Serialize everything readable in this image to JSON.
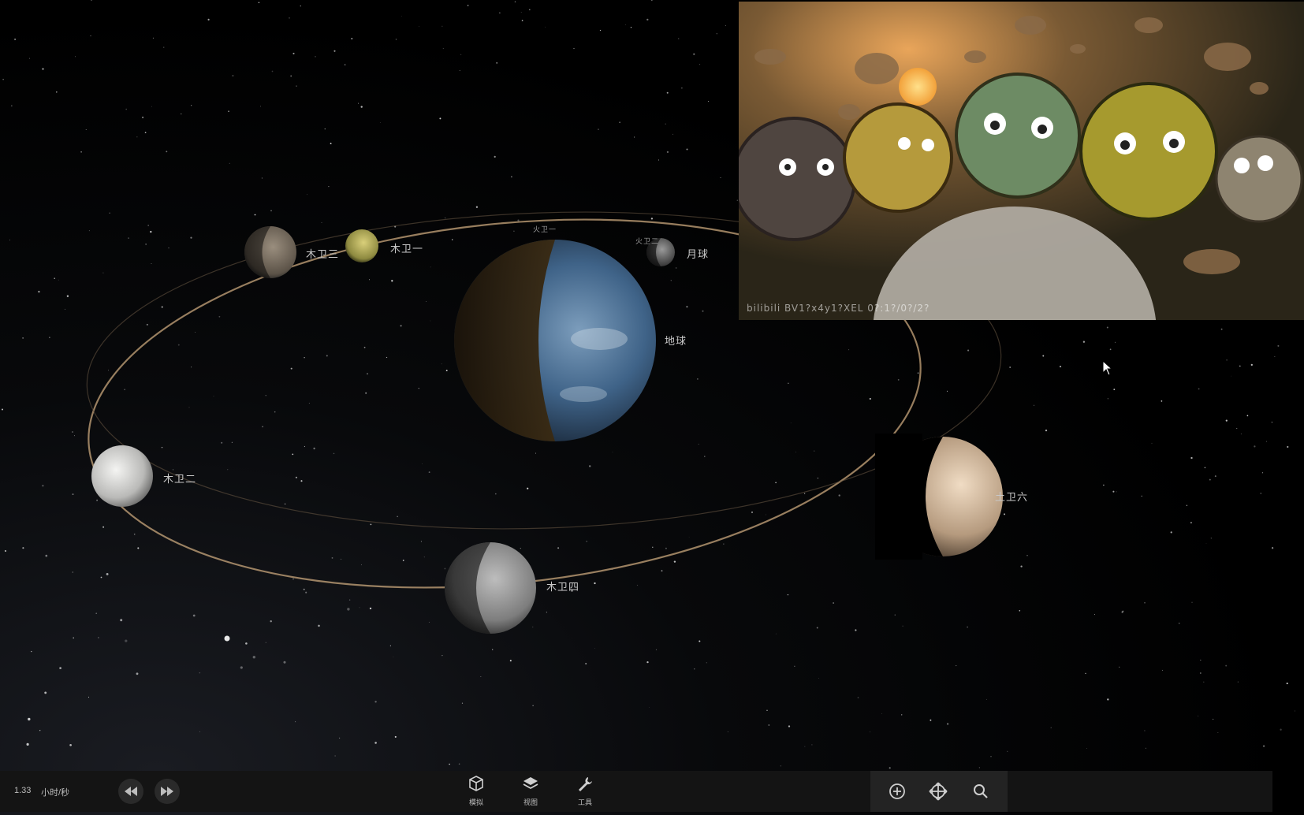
{
  "scene": {
    "bodies": [
      {
        "id": "callisto",
        "label": "木卫四"
      },
      {
        "id": "europa",
        "label": "木卫二"
      },
      {
        "id": "ganymede",
        "label": "木卫三"
      },
      {
        "id": "io",
        "label": "木卫一"
      },
      {
        "id": "earth",
        "label": "地球"
      },
      {
        "id": "moon",
        "label": "月球"
      },
      {
        "id": "titan",
        "label": "土卫六"
      },
      {
        "id": "phobos",
        "label": "火卫一"
      },
      {
        "id": "deimos",
        "label": "火卫二"
      }
    ],
    "colors": {
      "orbit": "#c9a77c",
      "background": "#000000"
    }
  },
  "inset": {
    "watermark": "bilibili BV1?x4y1?XEL 0?:1?/0?/2?"
  },
  "toolbar": {
    "speed_value": "1.33",
    "speed_unit": "小时/秒",
    "rewind_icon": "rewind-icon",
    "forward_icon": "fast-forward-icon",
    "menu": [
      {
        "label": "模拟",
        "icon": "cube-icon"
      },
      {
        "label": "视图",
        "icon": "layers-icon"
      },
      {
        "label": "工具",
        "icon": "wrench-icon"
      }
    ],
    "nav": [
      {
        "icon": "zoom-plus-icon"
      },
      {
        "icon": "move-icon"
      },
      {
        "icon": "search-icon"
      }
    ]
  }
}
